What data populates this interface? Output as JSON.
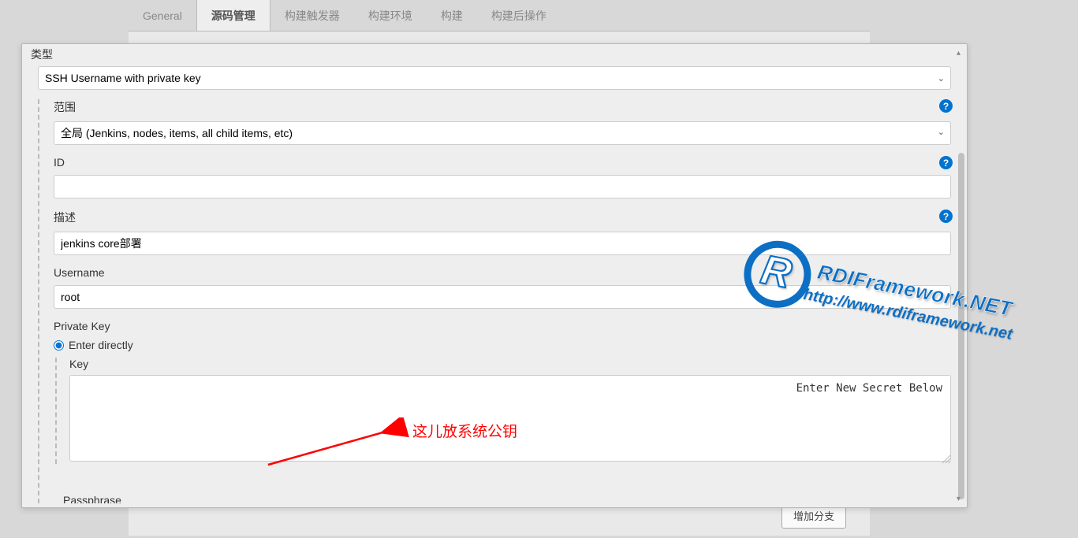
{
  "tabs": [
    {
      "label": "General",
      "active": false
    },
    {
      "label": "源码管理",
      "active": true
    },
    {
      "label": "构建触发器",
      "active": false
    },
    {
      "label": "构建环境",
      "active": false
    },
    {
      "label": "构建",
      "active": false
    },
    {
      "label": "构建后操作",
      "active": false
    }
  ],
  "addBranch": "增加分支",
  "modal": {
    "typeLabel": "类型",
    "typeValue": "SSH Username with private key",
    "scope": {
      "label": "范围",
      "value": "全局 (Jenkins, nodes, items, all child items, etc)"
    },
    "id": {
      "label": "ID",
      "value": ""
    },
    "desc": {
      "label": "描述",
      "value": "jenkins core部署"
    },
    "username": {
      "label": "Username",
      "value": "root"
    },
    "privateKey": {
      "label": "Private Key",
      "enterDirectly": "Enter directly",
      "keyLabel": "Key",
      "keyPlaceholder": "Enter New Secret Below"
    },
    "passphrase": "Passphrase"
  },
  "annotation": "这儿放系统公钥",
  "watermark": {
    "name": "RDIFramework.NET",
    "url": "http://www.rdiframework.net"
  }
}
